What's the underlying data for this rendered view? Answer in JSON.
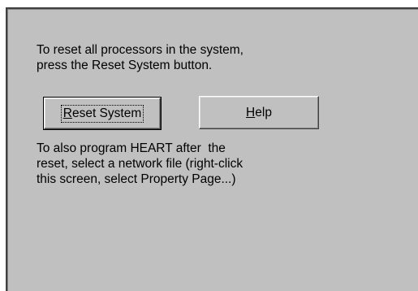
{
  "panel": {
    "intro_lines": [
      "To reset all processors in the system,",
      "press the Reset System button."
    ],
    "reset_button": {
      "mnemonic": "R",
      "rest": "eset System",
      "focused": true
    },
    "help_button": {
      "mnemonic": "H",
      "rest": "elp"
    },
    "followup_lines": [
      "To also program HEART after  the",
      "reset, select a network file (right-click",
      "this screen, select Property Page...)"
    ]
  },
  "colors": {
    "panel_face": "#c0c0c0",
    "panel_shadow": "#404040",
    "text": "#000000",
    "page_background": "#ffffff"
  }
}
